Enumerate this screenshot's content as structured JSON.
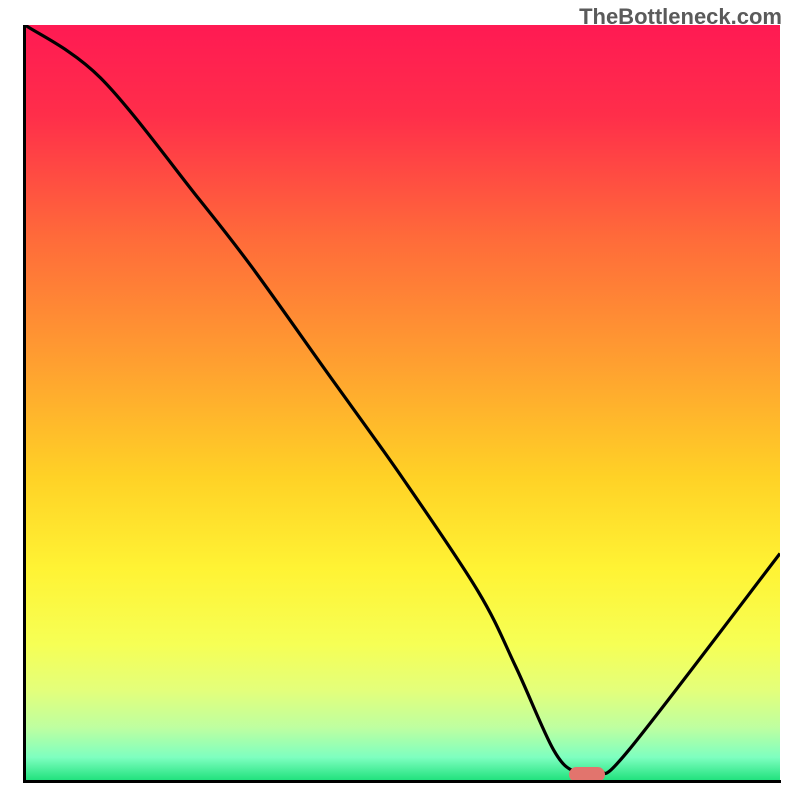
{
  "watermark": "TheBottleneck.com",
  "chart_data": {
    "type": "line",
    "title": "",
    "xlabel": "",
    "ylabel": "",
    "x_range": [
      0,
      100
    ],
    "y_range": [
      0,
      100
    ],
    "series": [
      {
        "name": "bottleneck-curve",
        "x": [
          0,
          10,
          23,
          30,
          40,
          50,
          60,
          65,
          70,
          73,
          76,
          80,
          100
        ],
        "y": [
          100,
          93,
          77,
          68,
          54,
          40,
          25,
          15,
          4,
          1,
          1,
          4,
          30
        ]
      }
    ],
    "optimal_marker": {
      "x": 74.5,
      "y": 0.8
    },
    "gradient_stops": [
      {
        "offset": 0.0,
        "color": "#ff1a53"
      },
      {
        "offset": 0.12,
        "color": "#ff2e4a"
      },
      {
        "offset": 0.28,
        "color": "#ff6a3a"
      },
      {
        "offset": 0.45,
        "color": "#ffa030"
      },
      {
        "offset": 0.6,
        "color": "#ffd226"
      },
      {
        "offset": 0.72,
        "color": "#fff334"
      },
      {
        "offset": 0.82,
        "color": "#f6ff55"
      },
      {
        "offset": 0.88,
        "color": "#e4ff7a"
      },
      {
        "offset": 0.93,
        "color": "#bfffa0"
      },
      {
        "offset": 0.97,
        "color": "#7effc0"
      },
      {
        "offset": 1.0,
        "color": "#22e27e"
      }
    ]
  }
}
